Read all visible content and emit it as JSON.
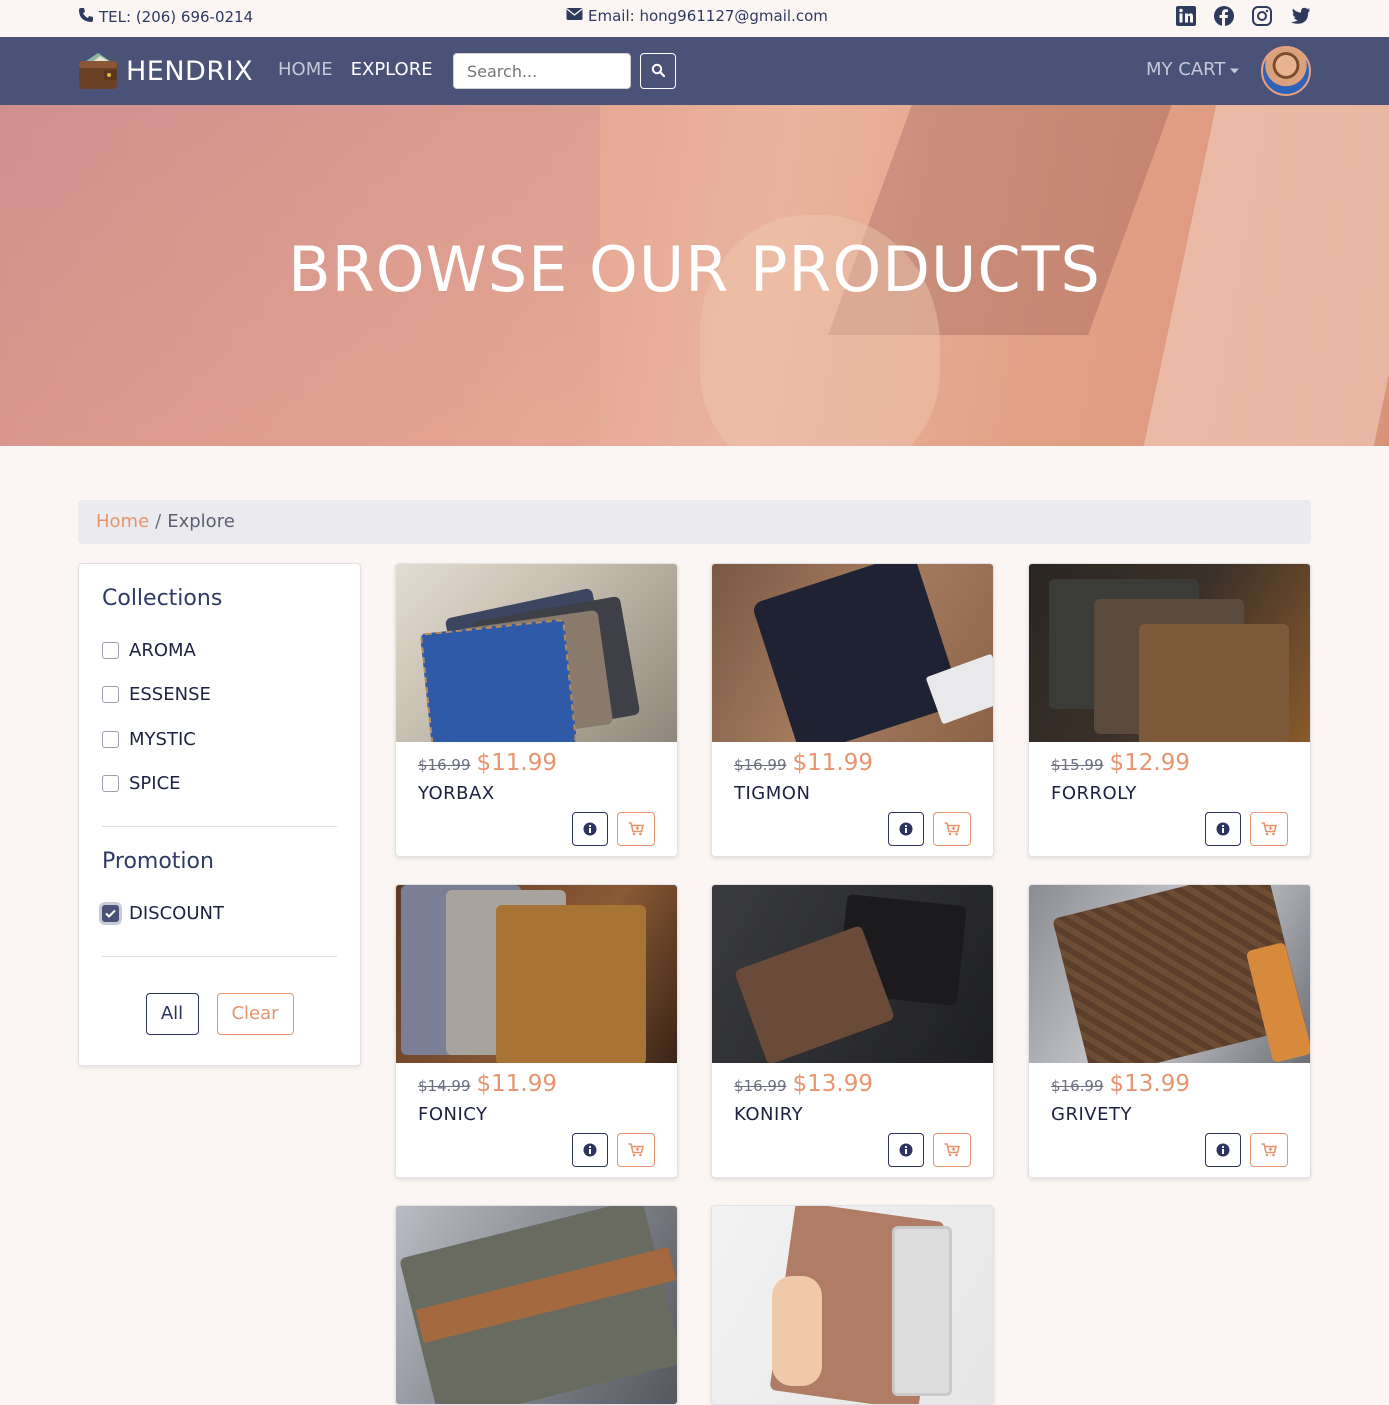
{
  "topbar": {
    "tel": "TEL: (206) 696-0214",
    "email": "Email: hong961127@gmail.com"
  },
  "navbar": {
    "brand": "HENDRIX",
    "links": [
      "HOME",
      "EXPLORE"
    ],
    "search_placeholder": "Search...",
    "cart_label": "MY CART"
  },
  "hero": {
    "title": "BROWSE OUR PRODUCTS"
  },
  "breadcrumb": {
    "home": "Home",
    "separator": "/",
    "current": "Explore"
  },
  "filters": {
    "collections_title": "Collections",
    "collections": [
      {
        "label": "AROMA",
        "checked": false
      },
      {
        "label": "ESSENSE",
        "checked": false
      },
      {
        "label": "MYSTIC",
        "checked": false
      },
      {
        "label": "SPICE",
        "checked": false
      }
    ],
    "promotion_title": "Promotion",
    "promotions": [
      {
        "label": "DISCOUNT",
        "checked": true
      }
    ],
    "all_label": "All",
    "clear_label": "Clear"
  },
  "products": [
    {
      "name": "YORBAX",
      "old_price": "$16.99",
      "price": "$11.99"
    },
    {
      "name": "TIGMON",
      "old_price": "$16.99",
      "price": "$11.99"
    },
    {
      "name": "FORROLY",
      "old_price": "$15.99",
      "price": "$12.99"
    },
    {
      "name": "FONICY",
      "old_price": "$14.99",
      "price": "$11.99"
    },
    {
      "name": "KONIRY",
      "old_price": "$16.99",
      "price": "$13.99"
    },
    {
      "name": "GRIVETY",
      "old_price": "$16.99",
      "price": "$13.99"
    },
    {
      "name": "",
      "old_price": "",
      "price": ""
    },
    {
      "name": "",
      "old_price": "",
      "price": ""
    }
  ],
  "colors": {
    "nav": "#4a5277",
    "accent": "#e8946f",
    "text": "#2c3360"
  }
}
